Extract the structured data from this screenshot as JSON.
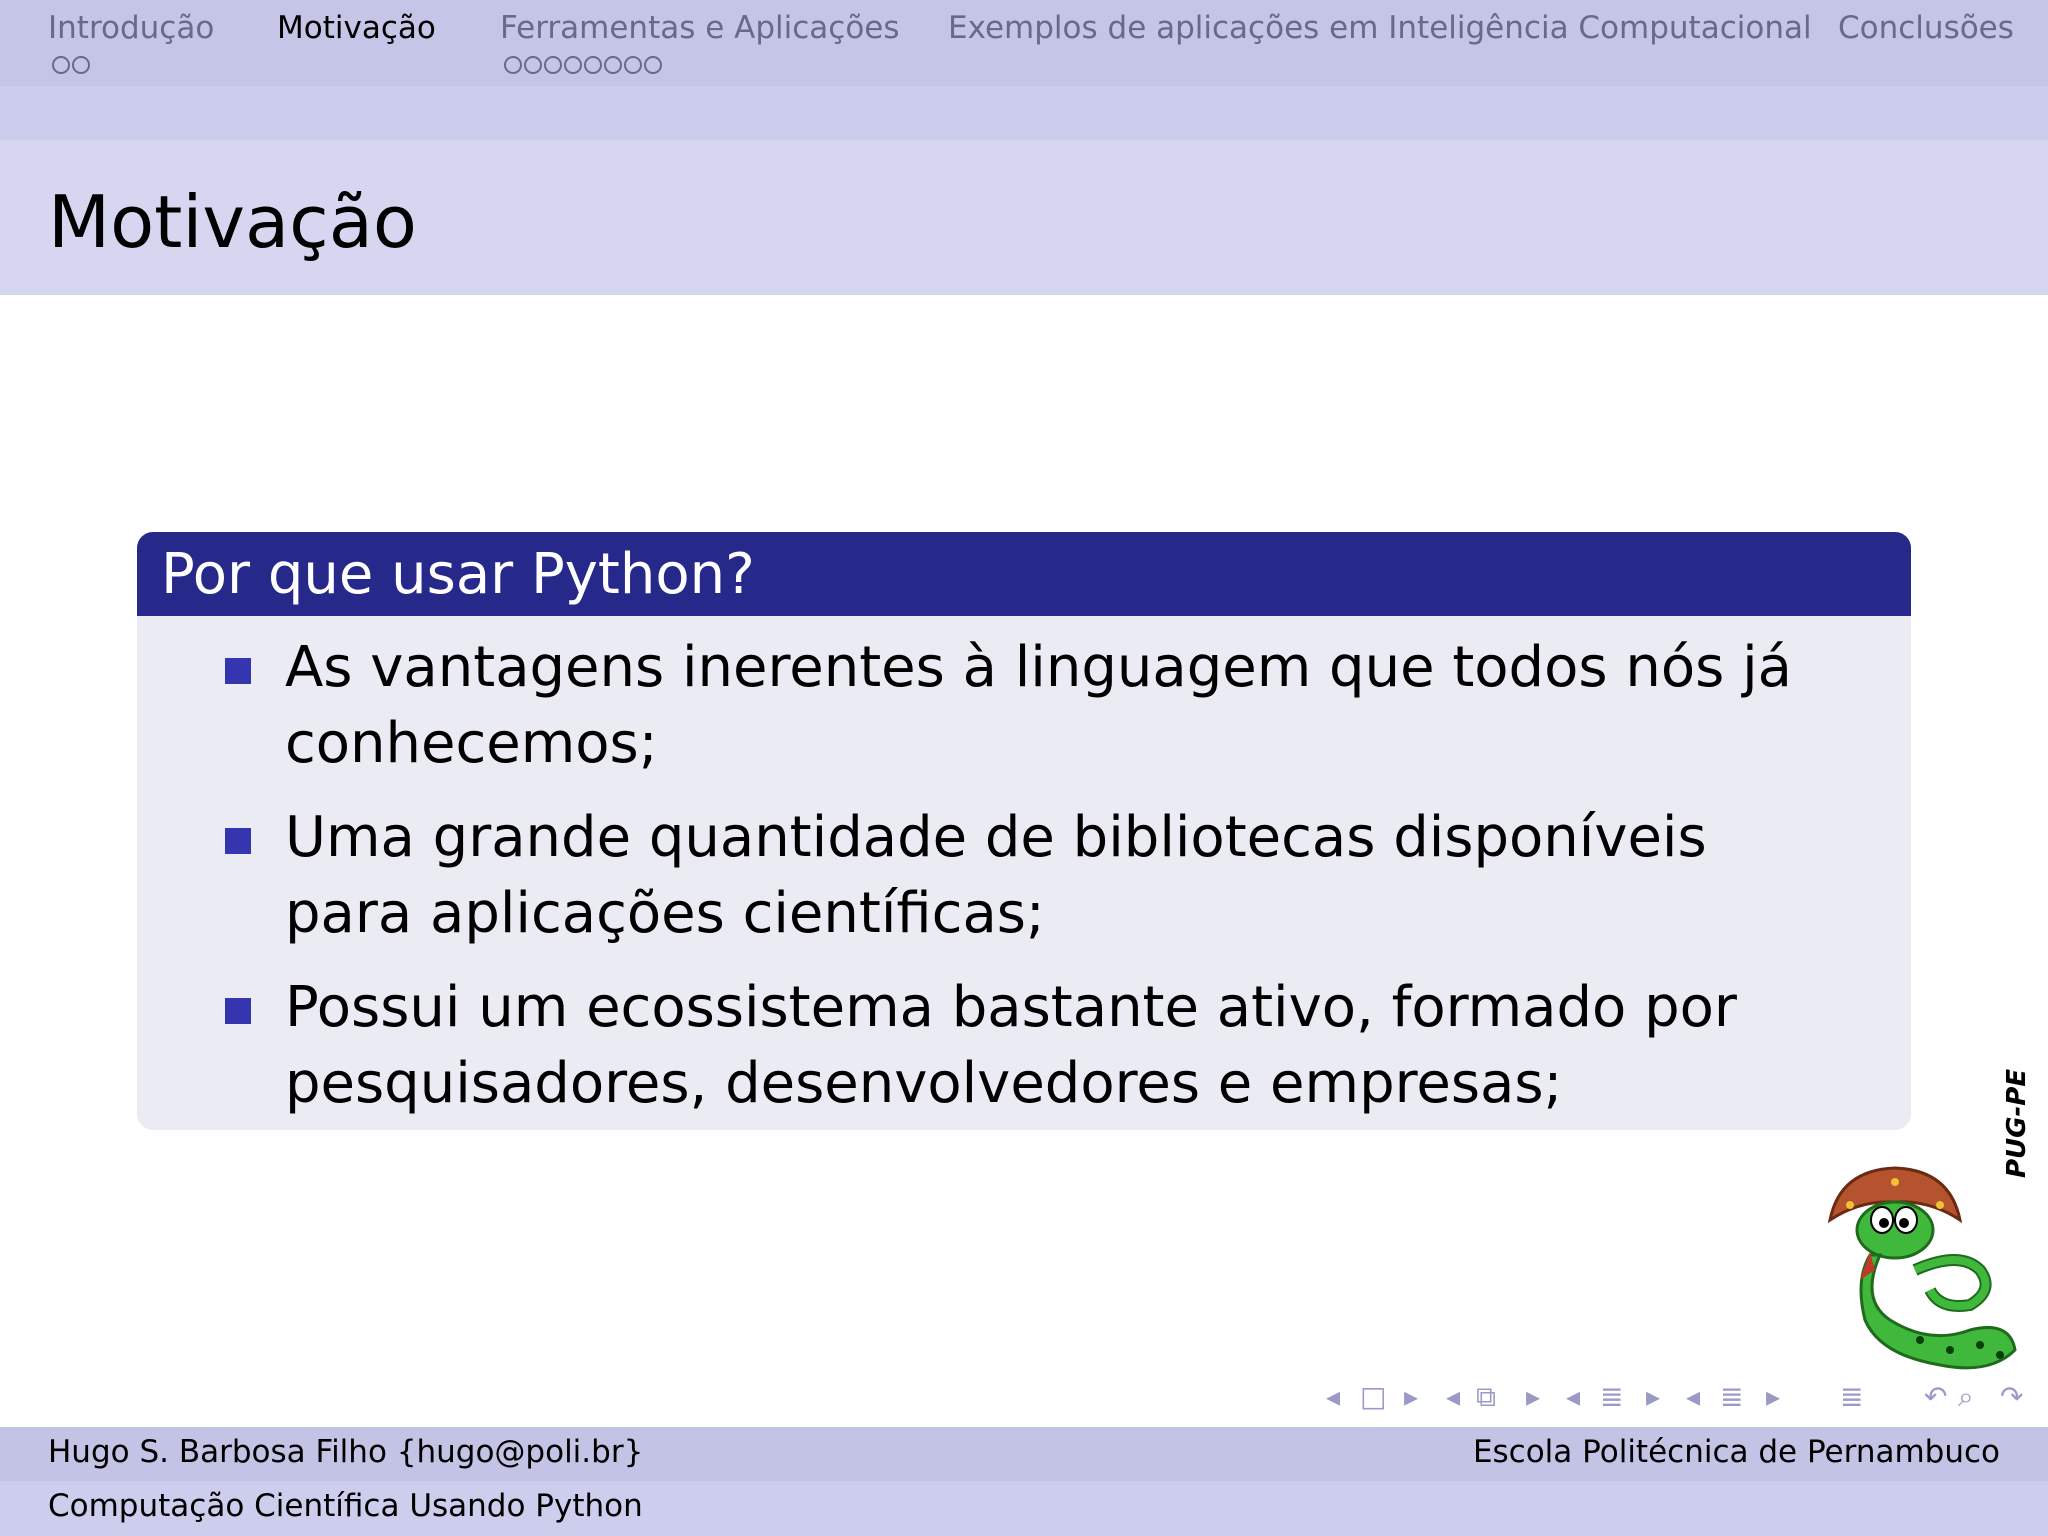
{
  "navbar": {
    "sections": [
      {
        "label": "Introdução",
        "dots": 2
      },
      {
        "label": "Motivação",
        "dots": 0
      },
      {
        "label": "Ferramentas e Aplicações",
        "dots": 8
      },
      {
        "label": "Exemplos de aplicações em Inteligência Computacional",
        "dots": 0
      },
      {
        "label": "Conclusões",
        "dots": 0
      }
    ],
    "active_index": 1
  },
  "frame": {
    "title": "Motivação"
  },
  "block": {
    "title": "Por que usar Python?",
    "items": [
      "As vantagens inerentes à linguagem que todos nós já conhecemos;",
      "Uma grande quantidade de bibliotecas disponíveis para aplicações científicas;",
      "Possui um ecossistema bastante ativo, formado por pesquisadores, desenvolvedores e empresas;"
    ]
  },
  "logo": {
    "text": "PUG-PE"
  },
  "footer": {
    "author": "Hugo S. Barbosa Filho {hugo@poli.br}",
    "institution": "Escola Politécnica de Pernambuco",
    "talk_title": "Computação Científica Usando Python"
  },
  "colors": {
    "accent": "#26288a",
    "bullet": "#3535b0",
    "nav_bg": "#c5c5e8",
    "block_body": "#ebebf3"
  }
}
